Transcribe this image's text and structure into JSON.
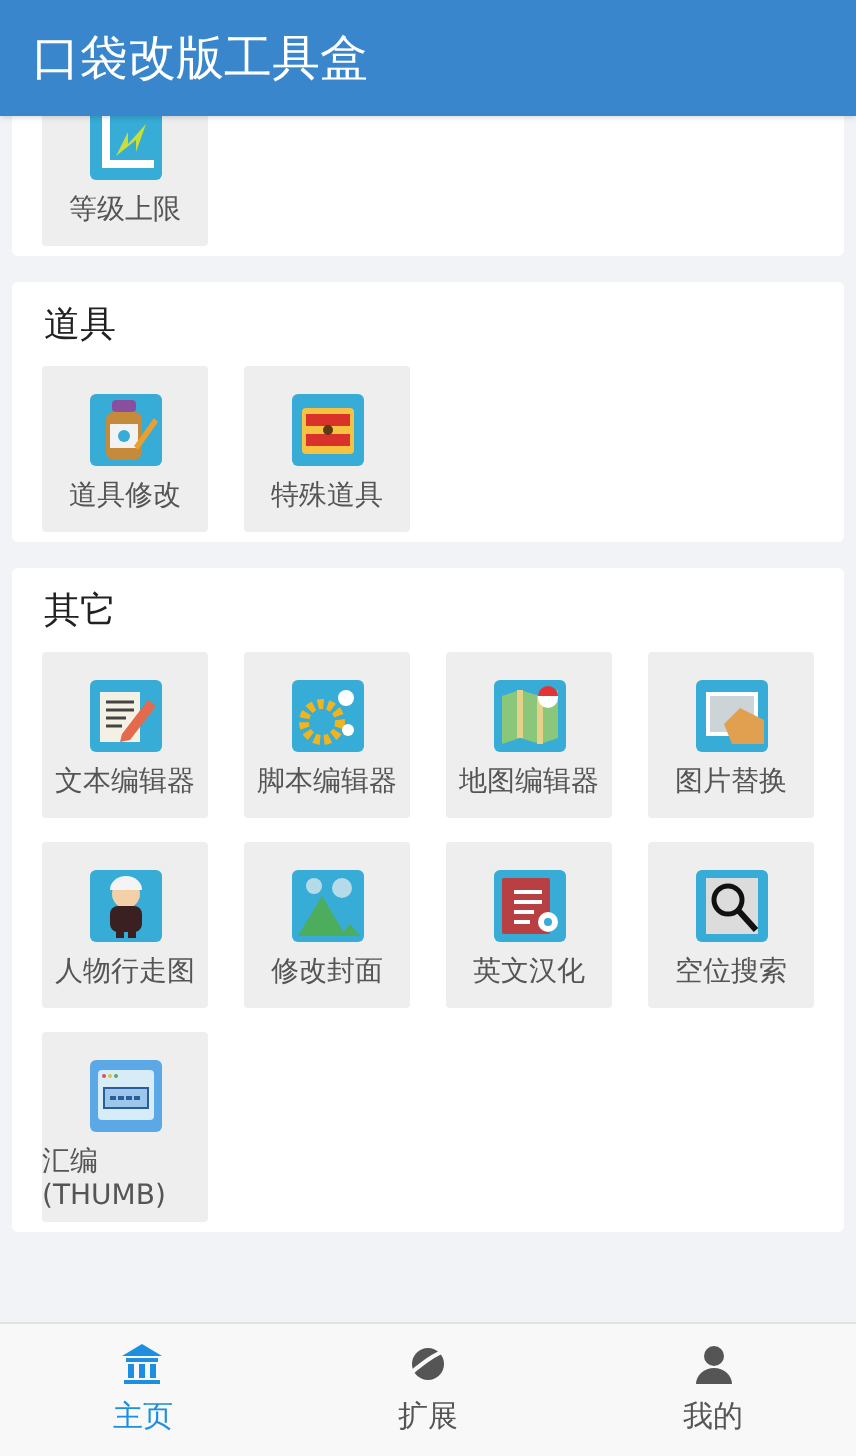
{
  "app_bar": {
    "title": "口袋改版工具盒"
  },
  "sections": [
    {
      "tools": [
        {
          "label": "等级上限"
        }
      ]
    },
    {
      "title": "道具",
      "tools": [
        {
          "label": "道具修改"
        },
        {
          "label": "特殊道具"
        }
      ]
    },
    {
      "title": "其它",
      "tools": [
        {
          "label": "文本编辑器"
        },
        {
          "label": "脚本编辑器"
        },
        {
          "label": "地图编辑器"
        },
        {
          "label": "图片替换"
        },
        {
          "label": "人物行走图"
        },
        {
          "label": "修改封面"
        },
        {
          "label": "英文汉化"
        },
        {
          "label": "空位搜索"
        },
        {
          "label": "汇编(THUMB)"
        }
      ]
    }
  ],
  "bottom_nav": [
    {
      "label": "主页",
      "selected": true
    },
    {
      "label": "扩展",
      "selected": false
    },
    {
      "label": "我的",
      "selected": false
    }
  ]
}
